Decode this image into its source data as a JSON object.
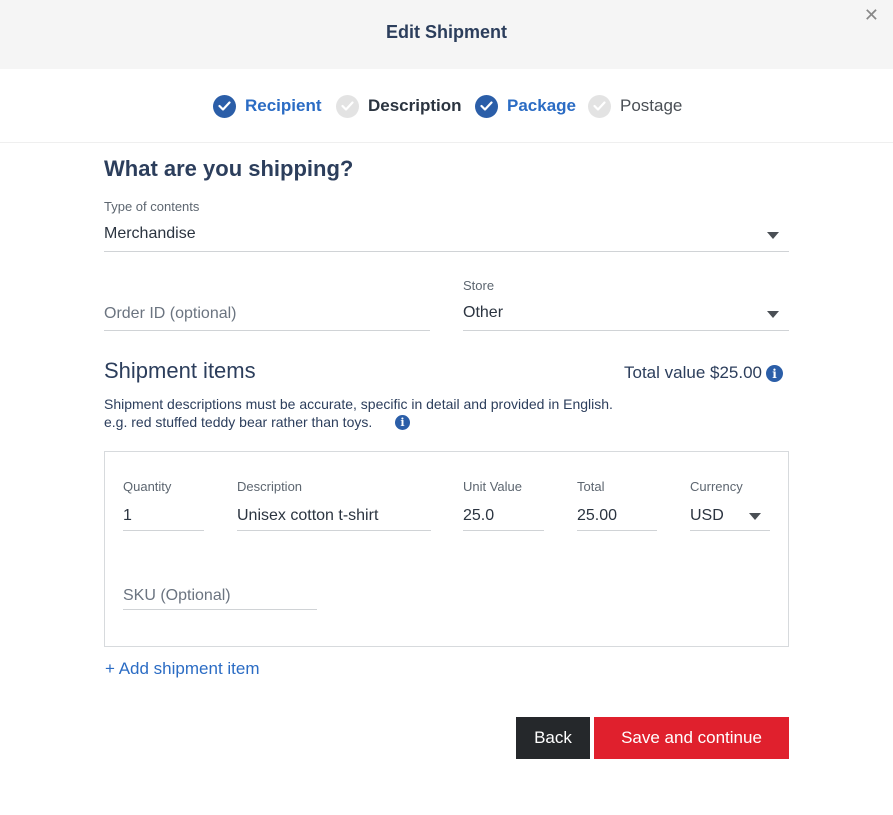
{
  "header": {
    "title": "Edit Shipment",
    "close_glyph": "✕"
  },
  "steps": [
    {
      "label": "Recipient",
      "state": "done"
    },
    {
      "label": "Description",
      "state": "current"
    },
    {
      "label": "Package",
      "state": "done"
    },
    {
      "label": "Postage",
      "state": "todo"
    }
  ],
  "form": {
    "title": "What are you shipping?",
    "contents_type": {
      "label": "Type of contents",
      "value": "Merchandise"
    },
    "order_id": {
      "placeholder": "Order ID (optional)"
    },
    "store": {
      "label": "Store",
      "value": "Other"
    }
  },
  "items": {
    "title": "Shipment items",
    "total_value": "Total value $25.00",
    "help_line1": "Shipment descriptions must be accurate, specific in detail and provided in English.",
    "help_line2": "e.g. red stuffed teddy bear rather than toys.",
    "columns": {
      "quantity": "Quantity",
      "description": "Description",
      "unit_value": "Unit Value",
      "total": "Total",
      "currency": "Currency"
    },
    "row": {
      "quantity": "1",
      "description": "Unisex cotton t-shirt",
      "unit_value": "25.0",
      "total": "25.00",
      "currency": "USD"
    },
    "sku_placeholder": "SKU (Optional)",
    "add_link": "+ Add shipment item"
  },
  "actions": {
    "back": "Back",
    "save": "Save and continue"
  },
  "colors": {
    "primary_blue": "#2b5ea8",
    "link_blue": "#2b6cc4",
    "danger_red": "#e0202d",
    "dark": "#25282b"
  },
  "icons": {
    "step_done": "check-icon",
    "info": "info-icon",
    "dropdown": "chevron-down-icon",
    "close": "close-icon"
  }
}
